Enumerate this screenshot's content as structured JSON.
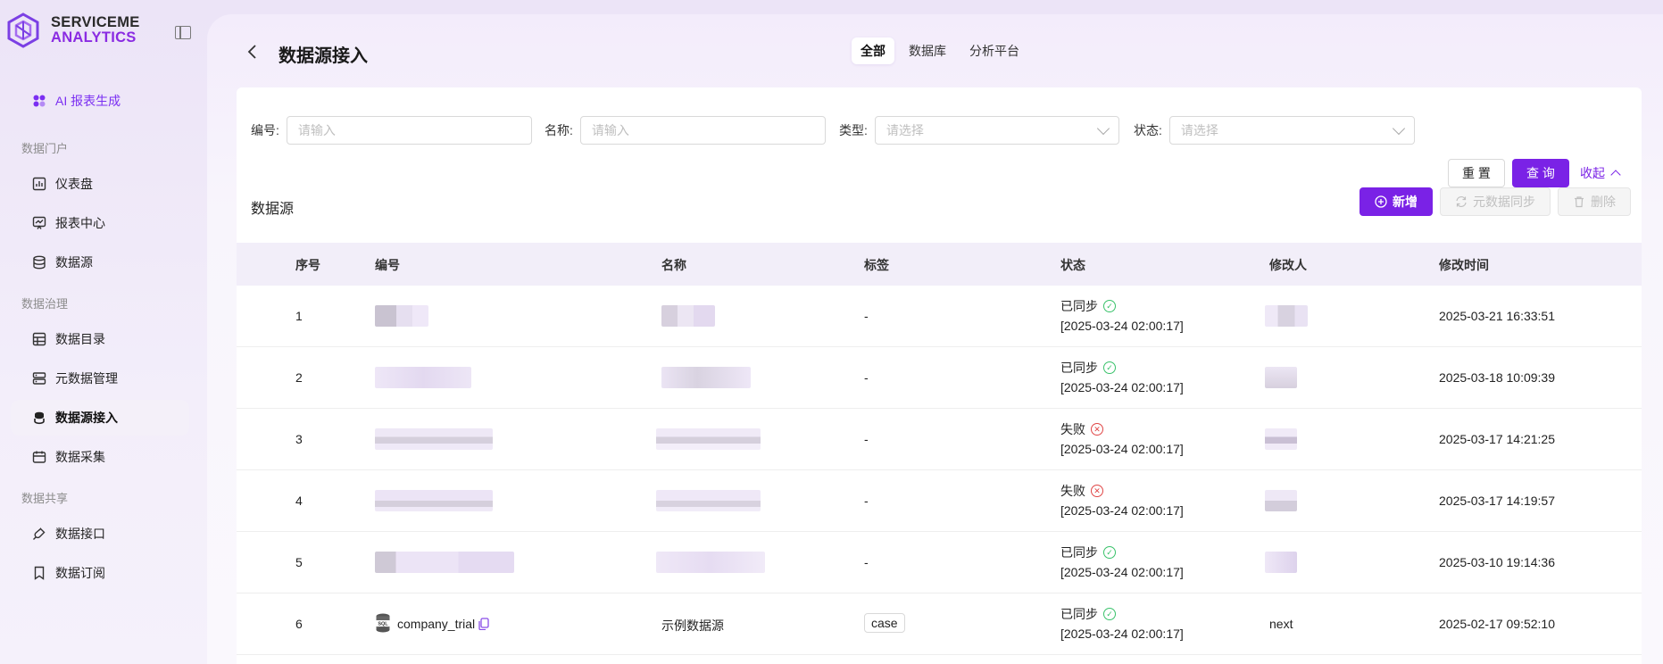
{
  "brand": {
    "line1": "SERVICEME",
    "line2": "ANALYTICS"
  },
  "sidebar": {
    "ai_item": "AI 报表生成",
    "groups": [
      {
        "label": "数据门户",
        "items": [
          "仪表盘",
          "报表中心",
          "数据源"
        ]
      },
      {
        "label": "数据治理",
        "items": [
          "数据目录",
          "元数据管理",
          "数据源接入",
          "数据采集"
        ]
      },
      {
        "label": "数据共享",
        "items": [
          "数据接口",
          "数据订阅"
        ]
      }
    ],
    "active_item": "数据源接入"
  },
  "header": {
    "title": "数据源接入",
    "tabs": [
      "全部",
      "数据库",
      "分析平台"
    ],
    "active_tab": "全部"
  },
  "filters": {
    "code_label": "编号:",
    "code_placeholder": "请输入",
    "name_label": "名称:",
    "name_placeholder": "请输入",
    "type_label": "类型:",
    "type_placeholder": "请选择",
    "status_label": "状态:",
    "status_placeholder": "请选择",
    "reset": "重 置",
    "query": "查 询",
    "fold": "收起"
  },
  "section": {
    "title": "数据源",
    "add": "新增",
    "sync": "元数据同步",
    "delete": "删除"
  },
  "table": {
    "columns": [
      "序号",
      "编号",
      "名称",
      "标签",
      "状态",
      "修改人",
      "修改时间"
    ],
    "rows": [
      {
        "index": "1",
        "code": "",
        "name": "",
        "tag": "-",
        "status": "已同步",
        "status_ok": true,
        "sync_time": "[2025-03-24 02:00:17]",
        "modifier": "",
        "modified": "2025-03-21 16:33:51"
      },
      {
        "index": "2",
        "code": "",
        "name": "",
        "tag": "-",
        "status": "已同步",
        "status_ok": true,
        "sync_time": "[2025-03-24 02:00:17]",
        "modifier": "",
        "modified": "2025-03-18 10:09:39"
      },
      {
        "index": "3",
        "code": "",
        "name": "",
        "tag": "-",
        "status": "失败",
        "status_ok": false,
        "sync_time": "[2025-03-24 02:00:17]",
        "modifier": "",
        "modified": "2025-03-17 14:21:25"
      },
      {
        "index": "4",
        "code": "",
        "name": "",
        "tag": "-",
        "status": "失败",
        "status_ok": false,
        "sync_time": "[2025-03-24 02:00:17]",
        "modifier": "",
        "modified": "2025-03-17 14:19:57"
      },
      {
        "index": "5",
        "code": "",
        "name": "",
        "tag": "-",
        "status": "已同步",
        "status_ok": true,
        "sync_time": "[2025-03-24 02:00:17]",
        "modifier": "",
        "modified": "2025-03-10 19:14:36"
      },
      {
        "index": "6",
        "code": "company_trial",
        "name": "示例数据源",
        "tag": "case",
        "status": "已同步",
        "status_ok": true,
        "sync_time": "[2025-03-24 02:00:17]",
        "modifier": "next",
        "modified": "2025-02-17 09:52:10"
      }
    ]
  },
  "colors": {
    "accent": "#7a22e6",
    "ok": "#39c26a",
    "fail": "#e04545"
  }
}
